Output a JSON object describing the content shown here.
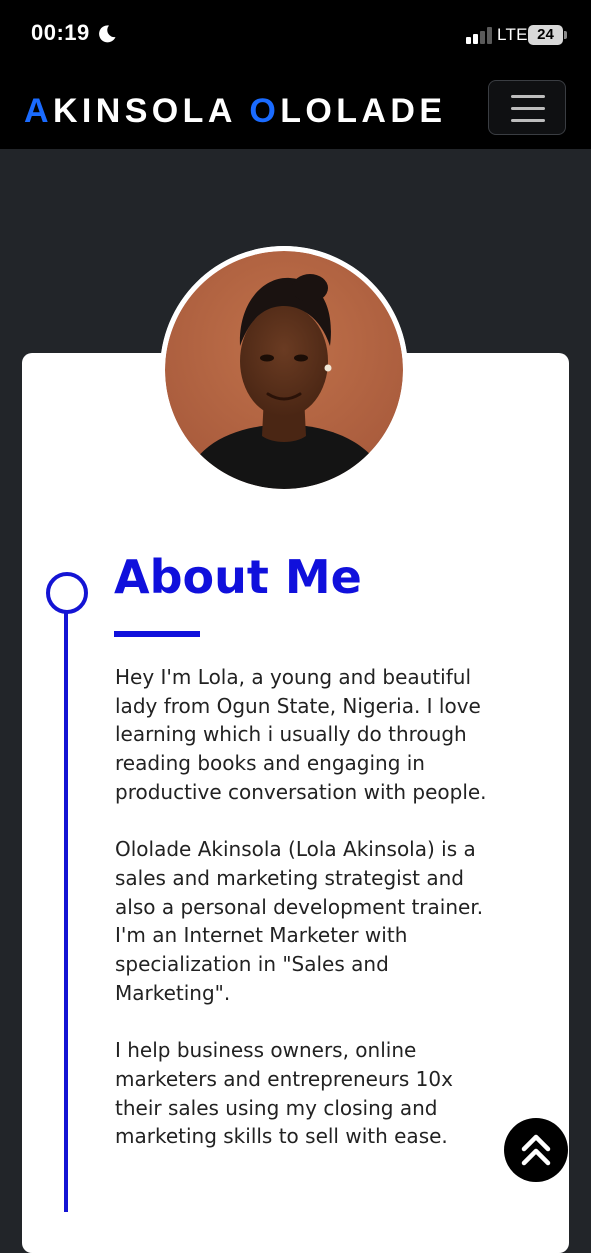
{
  "status_bar": {
    "time": "00:19",
    "network": "LTE",
    "battery": "24",
    "icons": [
      "moon-icon",
      "signal-icon",
      "battery-icon"
    ]
  },
  "header": {
    "brand_first_initial": "A",
    "brand_first_rest": "KINSOLA",
    "brand_last_initial": "O",
    "brand_last_rest": "LOLADE",
    "accent_color": "#1a6bff",
    "menu_icon": "hamburger-icon"
  },
  "about": {
    "title": "About Me",
    "title_color": "#1010dc",
    "paragraphs": [
      "Hey I'm Lola, a young and beautiful lady from Ogun State, Nigeria. I love learning which i usually do through reading books and engaging in productive conversation with people.",
      "Ololade Akinsola (Lola Akinsola) is a sales and marketing strategist and also a personal development trainer. I'm an Internet Marketer with specialization in \"Sales and Marketing\".",
      "I help business owners, online marketers and entrepreneurs 10x their sales using my closing and marketing skills to sell with ease."
    ]
  },
  "scroll_top": {
    "icon": "double-chevron-up-icon"
  },
  "colors": {
    "page_bg": "#222529",
    "header_bg": "#000000",
    "card_bg": "#ffffff"
  }
}
